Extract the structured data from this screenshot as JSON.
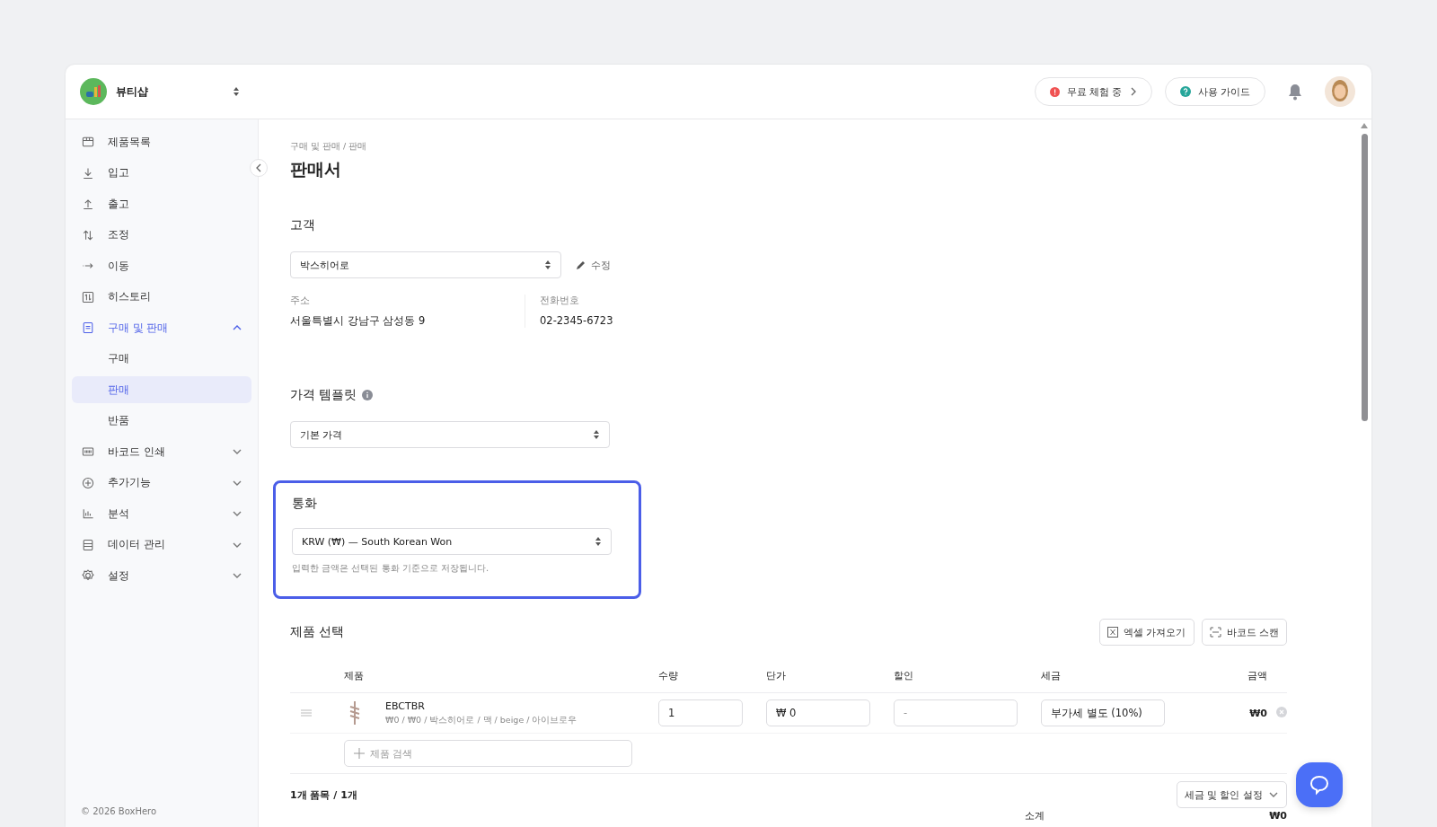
{
  "header": {
    "store_name": "뷰티샵",
    "trial_badge": "무료 체험 중",
    "guide_button": "사용 가이드"
  },
  "sidebar": {
    "items": [
      {
        "label": "제품목록",
        "selected": false
      },
      {
        "label": "입고",
        "selected": false
      },
      {
        "label": "출고",
        "selected": false
      },
      {
        "label": "조정",
        "selected": false
      },
      {
        "label": "이동",
        "selected": false
      },
      {
        "label": "히스토리",
        "selected": false
      },
      {
        "label": "구매 및 판매",
        "selected": true,
        "expanded": true,
        "children": [
          {
            "label": "구매",
            "selected": false
          },
          {
            "label": "판매",
            "selected": true
          },
          {
            "label": "반품",
            "selected": false
          }
        ]
      },
      {
        "label": "바코드 인쇄",
        "selected": false,
        "expanded": false
      },
      {
        "label": "추가기능",
        "selected": false,
        "expanded": false
      },
      {
        "label": "분석",
        "selected": false,
        "expanded": false
      },
      {
        "label": "데이터 관리",
        "selected": false,
        "expanded": false
      },
      {
        "label": "설정",
        "selected": false,
        "expanded": false
      }
    ],
    "footer": "© 2026 BoxHero"
  },
  "breadcrumb": "구매 및 판매 / 판매",
  "page_title": "판매서",
  "customer": {
    "heading": "고객",
    "value": "박스히어로",
    "edit_link": "수정",
    "address_label": "주소",
    "address": "서울특별시 강남구 삼성동 9",
    "phone_label": "전화번호",
    "phone": "02-2345-6723"
  },
  "price_template": {
    "heading": "가격 템플릿",
    "value": "기본 가격"
  },
  "currency": {
    "heading": "통화",
    "value": "KRW (₩) — South Korean Won",
    "hint": "입력한 금액은 선택된 통화 기준으로 저장됩니다.",
    "highlighted": true
  },
  "products": {
    "heading": "제품 선택",
    "buttons": [
      "엑셀 가져오기",
      "바코드 스캔"
    ],
    "table": {
      "columns": [
        "제품",
        "수량",
        "단가",
        "할인",
        "세금",
        "금액"
      ],
      "rows": [
        {
          "name": "EBCTBR",
          "details": "₩0 / ₩0 / 박스히어로 / 맥 / beige / 아이브로우",
          "quantity": "1",
          "unit_price": "₩ 0",
          "discount_placeholder": "-",
          "tax": "부가세 별도 (10%)",
          "amount": "₩0"
        }
      ]
    },
    "search": {
      "placeholder": "제품 검색"
    },
    "summary": "1개 품목 / 1개",
    "settings_button": "세금 및 할인 설정",
    "subtotal_label": "소계",
    "subtotal": "₩0"
  }
}
